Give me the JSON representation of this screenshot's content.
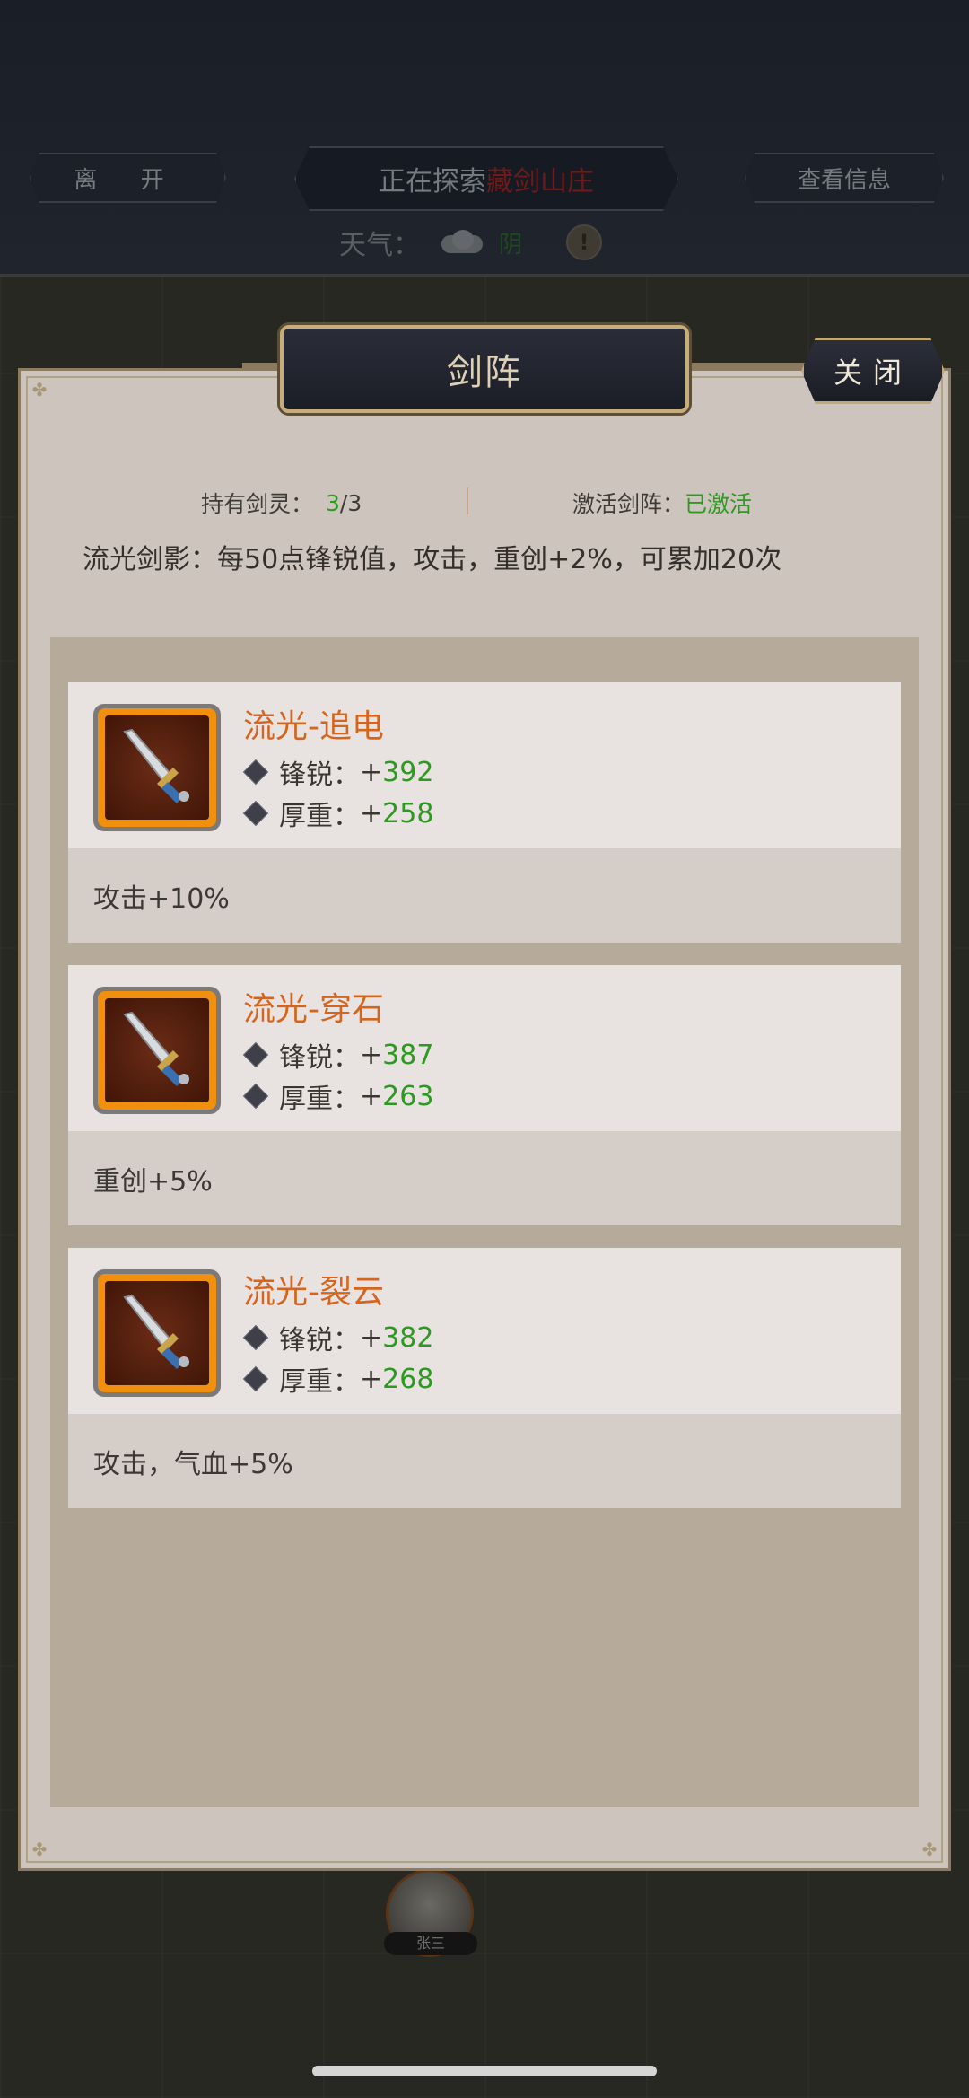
{
  "topbar": {
    "leave_label": "离 开",
    "exploring_prefix": "正在探索",
    "exploring_location": "藏剑山庄",
    "info_label": "查看信息",
    "weather_label": "天气：",
    "weather_value": "阴",
    "warn_symbol": "!"
  },
  "panel": {
    "title": "剑阵",
    "close_label": "关闭",
    "held_label": "持有剑灵：",
    "held_value": "3",
    "held_total": "/3",
    "activate_label": "激活剑阵：",
    "activate_value": "已激活",
    "effect_text": "流光剑影：每50点锋锐值，攻击，重创+2%，可累加20次"
  },
  "cards": [
    {
      "name": "流光-追电",
      "sharp_label": "锋锐：",
      "sharp_value": "+392",
      "heavy_label": "厚重：",
      "heavy_value": "+258",
      "bonus": "攻击+10%",
      "icon": "sword-icon"
    },
    {
      "name": "流光-穿石",
      "sharp_label": "锋锐：",
      "sharp_value": "+387",
      "heavy_label": "厚重：",
      "heavy_value": "+263",
      "bonus": "重创+5%",
      "icon": "sword-icon"
    },
    {
      "name": "流光-裂云",
      "sharp_label": "锋锐：",
      "sharp_value": "+382",
      "heavy_label": "厚重：",
      "heavy_value": "+268",
      "bonus": "攻击，气血+5%",
      "icon": "sword-icon"
    }
  ],
  "bottom": {
    "avatar_name": "张三"
  },
  "colors": {
    "accent_orange": "#d4651e",
    "value_green": "#2c9a20",
    "panel_bg": "#cdc5bd",
    "title_gold": "#c6ad7a"
  }
}
